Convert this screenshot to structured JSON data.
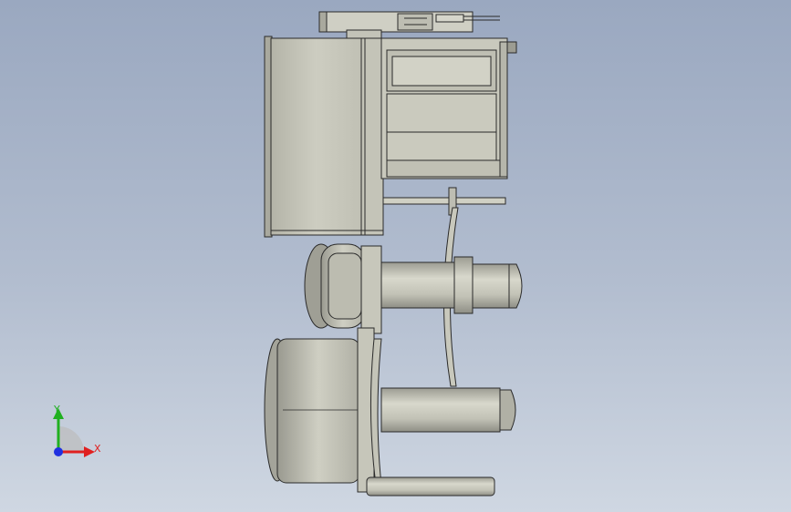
{
  "viewport": {
    "background_top": "#9aa8c0",
    "background_bottom": "#cfd7e2"
  },
  "model": {
    "body_color": "#c8c8bc",
    "edge_color": "#2a2a2a",
    "shade_color": "#a9a99e"
  },
  "triad": {
    "x_label": "X",
    "y_label": "Y",
    "x_color": "#e02020",
    "y_color": "#20b020",
    "z_color": "#2030e0"
  }
}
